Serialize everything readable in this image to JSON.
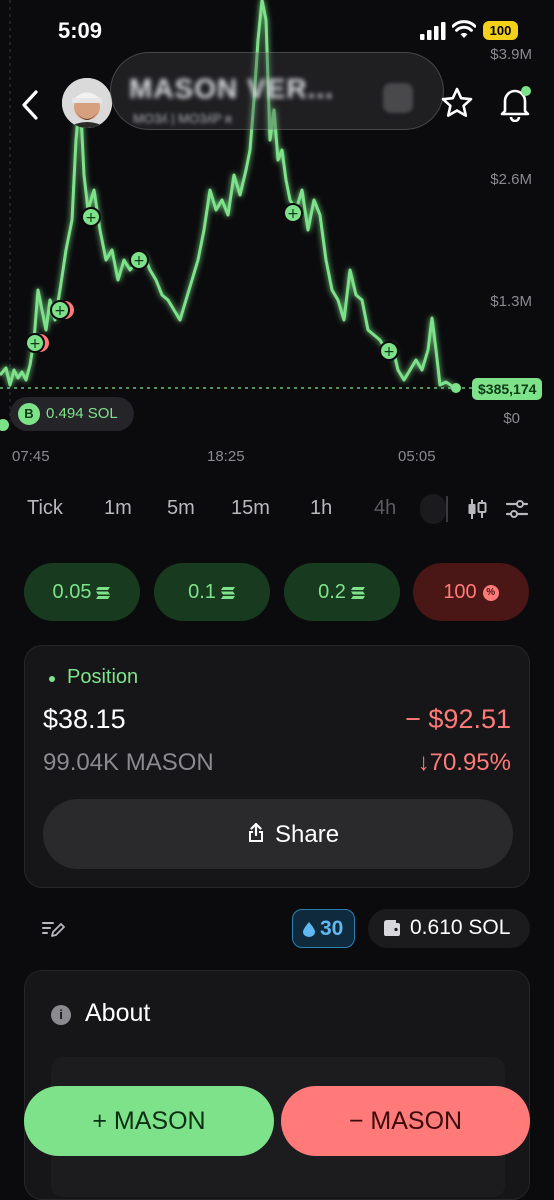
{
  "status_bar": {
    "time": "5:09",
    "battery": "100"
  },
  "header": {
    "token_name": "MASON VER...",
    "token_sub": "MO3ʎ | MO3ʎP ʀ"
  },
  "chart": {
    "y_labels": [
      "$3.9M",
      "$2.6M",
      "$1.3M",
      "$0"
    ],
    "x_labels": [
      "07:45",
      "18:25",
      "05:05"
    ],
    "current_price": "$385,174",
    "buy_marker": {
      "letter": "B",
      "amount": "0.494 SOL"
    },
    "line_color": "#7ee28b"
  },
  "timeframes": [
    {
      "label": "Tick",
      "active": true
    },
    {
      "label": "1m",
      "active": true
    },
    {
      "label": "5m",
      "active": true
    },
    {
      "label": "15m",
      "active": true
    },
    {
      "label": "1h",
      "active": true
    },
    {
      "label": "4h",
      "active": false
    }
  ],
  "quick_buy": [
    {
      "label": "0.05"
    },
    {
      "label": "0.1"
    },
    {
      "label": "0.2"
    }
  ],
  "quick_sell": {
    "label": "100"
  },
  "position": {
    "title": "Position",
    "value": "$38.15",
    "pnl": "− $92.51",
    "quantity": "99.04K MASON",
    "pnl_pct": "↓70.95%",
    "share_label": "Share"
  },
  "slippage": "30",
  "wallet_balance": "0.610 SOL",
  "about": {
    "title": "About",
    "icon_letter": "i"
  },
  "actions": {
    "buy_label": "+ MASON",
    "sell_label": "− MASON"
  },
  "colors": {
    "green": "#7ee28b",
    "red": "#ff7a78",
    "background": "#0b0b0d"
  }
}
